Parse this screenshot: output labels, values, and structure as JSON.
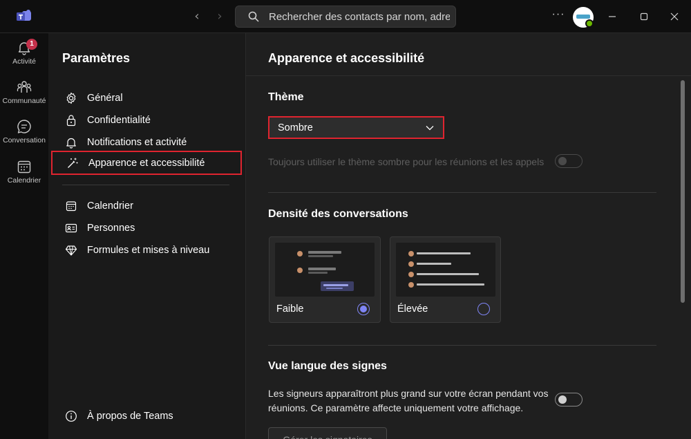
{
  "titlebar": {
    "search_placeholder": "Rechercher des contacts par nom, adresse",
    "more_label": "···"
  },
  "rail": {
    "items": [
      {
        "label": "Activité",
        "badge": "1"
      },
      {
        "label": "Communauté"
      },
      {
        "label": "Conversation"
      },
      {
        "label": "Calendrier"
      }
    ]
  },
  "settings": {
    "title": "Paramètres",
    "items": [
      {
        "label": "Général"
      },
      {
        "label": "Confidentialité"
      },
      {
        "label": "Notifications et activité"
      },
      {
        "label": "Apparence et accessibilité"
      },
      {
        "label": "Calendrier"
      },
      {
        "label": "Personnes"
      },
      {
        "label": "Formules et mises à niveau"
      }
    ],
    "about": "À propos de Teams"
  },
  "main": {
    "title": "Apparence et accessibilité",
    "theme": {
      "heading": "Thème",
      "selected": "Sombre",
      "always_dark_label": "Toujours utiliser le thème sombre pour les réunions et les appels"
    },
    "density": {
      "heading": "Densité des conversations",
      "options": [
        {
          "label": "Faible",
          "selected": true
        },
        {
          "label": "Élevée",
          "selected": false
        }
      ]
    },
    "sign_language": {
      "heading": "Vue langue des signes",
      "description": "Les signeurs apparaîtront plus grand sur votre écran pendant vos réunions. Ce paramètre affecte uniquement votre affichage.",
      "button": "Gérer les signataires"
    }
  },
  "colors": {
    "accent": "#7f85f5",
    "highlight": "#e0242f",
    "badge": "#c4314b"
  }
}
